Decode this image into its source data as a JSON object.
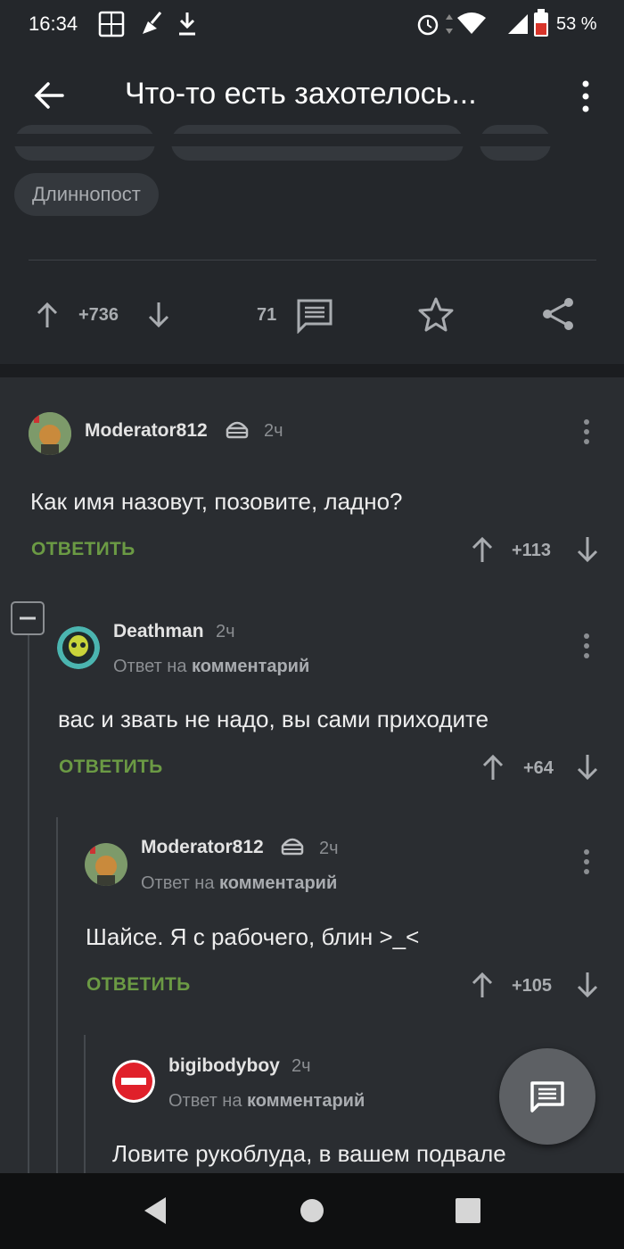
{
  "status_bar": {
    "time": "16:34",
    "battery_percent": "53 %"
  },
  "app_bar": {
    "title": "Что-то есть захотелось..."
  },
  "tags": [
    "Длиннопост"
  ],
  "post_actions": {
    "rating": "+736",
    "comments_count": "71"
  },
  "colors": {
    "accent_reply": "#6b9a44",
    "background": "#2a2d31",
    "toolbar": "#24272b"
  },
  "comments": [
    {
      "username": "Moderator812",
      "time": "2ч",
      "text": "Как имя назовут, позовите, ладно?",
      "reply_label": "ОТВЕТИТЬ",
      "rating": "+113"
    },
    {
      "username": "Deathman",
      "time": "2ч",
      "reply_prefix": "Ответ на",
      "reply_target": "комментарий",
      "text": "вас и звать не надо, вы сами приходите",
      "reply_label": "ОТВЕТИТЬ",
      "rating": "+64"
    },
    {
      "username": "Moderator812",
      "time": "2ч",
      "reply_prefix": "Ответ на",
      "reply_target": "комментарий",
      "text": "Шайсе. Я с рабочего, блин >_<",
      "reply_label": "ОТВЕТИТЬ",
      "rating": "+105"
    },
    {
      "username": "bigibodyboy",
      "time": "2ч",
      "reply_prefix": "Ответ на",
      "reply_target": "комментарий",
      "text": "Ловите рукоблуда, в вашем подвале"
    }
  ],
  "icons": [
    "back-arrow-icon",
    "more-vert-icon",
    "upvote-icon",
    "downvote-icon",
    "comment-icon",
    "star-icon",
    "share-icon",
    "collapse-icon",
    "moderator-cake-icon",
    "fab-comment-icon",
    "nav-back-icon",
    "nav-home-icon",
    "nav-recents-icon"
  ]
}
